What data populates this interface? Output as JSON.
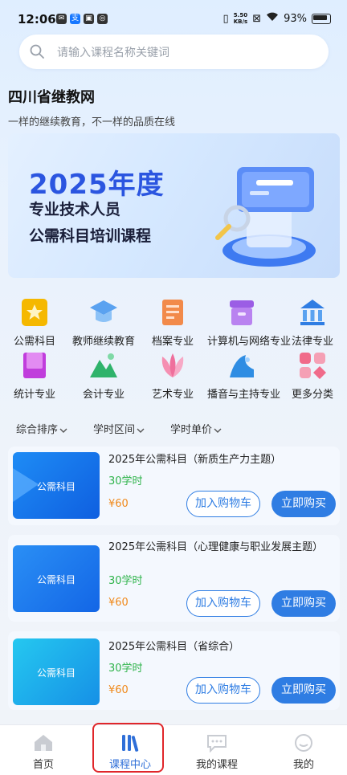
{
  "status": {
    "time": "12:06",
    "speed_top": "5.50",
    "speed_bottom": "KB/s",
    "battery": "93%"
  },
  "search": {
    "placeholder": "请输入课程名称关键词"
  },
  "brand": {
    "title": "四川省继教网",
    "slogan": "一样的继续教育，不一样的品质在线"
  },
  "banner": {
    "year": "2025年度",
    "line1": "专业技术人员",
    "line2": "公需科目培训课程"
  },
  "categories": [
    {
      "label": "公需科目",
      "icon": "star-badge-icon"
    },
    {
      "label": "教师继续教育",
      "icon": "graduation-cap-icon"
    },
    {
      "label": "档案专业",
      "icon": "scroll-icon"
    },
    {
      "label": "计算机与网络专业",
      "icon": "archive-box-icon"
    },
    {
      "label": "法律专业",
      "icon": "courthouse-icon"
    },
    {
      "label": "统计专业",
      "icon": "folder-icon"
    },
    {
      "label": "会计专业",
      "icon": "mountain-icon"
    },
    {
      "label": "艺术专业",
      "icon": "lotus-icon"
    },
    {
      "label": "播音与主持专业",
      "icon": "microphone-wave-icon"
    },
    {
      "label": "更多分类",
      "icon": "grid-more-icon"
    }
  ],
  "filters": [
    "综合排序",
    "学时区间",
    "学时单价"
  ],
  "courses": [
    {
      "thumb_label": "公需科目",
      "title": "2025年公需科目（新质生产力主题）",
      "hours": "30学时",
      "price": "¥60",
      "cart": "加入购物车",
      "buy": "立即购买"
    },
    {
      "thumb_label": "公需科目",
      "title": "2025年公需科目（心理健康与职业发展主题）",
      "hours": "30学时",
      "price": "¥60",
      "cart": "加入购物车",
      "buy": "立即购买"
    },
    {
      "thumb_label": "公需科目",
      "title": "2025年公需科目（省综合）",
      "hours": "30学时",
      "price": "¥60",
      "cart": "加入购物车",
      "buy": "立即购买"
    }
  ],
  "tabs": [
    "首页",
    "课程中心",
    "我的课程",
    "我的"
  ],
  "colors": {
    "accent": "#2f7de3",
    "hours": "#2eb34a",
    "price": "#f08a1c",
    "highlight": "#e0262a"
  }
}
